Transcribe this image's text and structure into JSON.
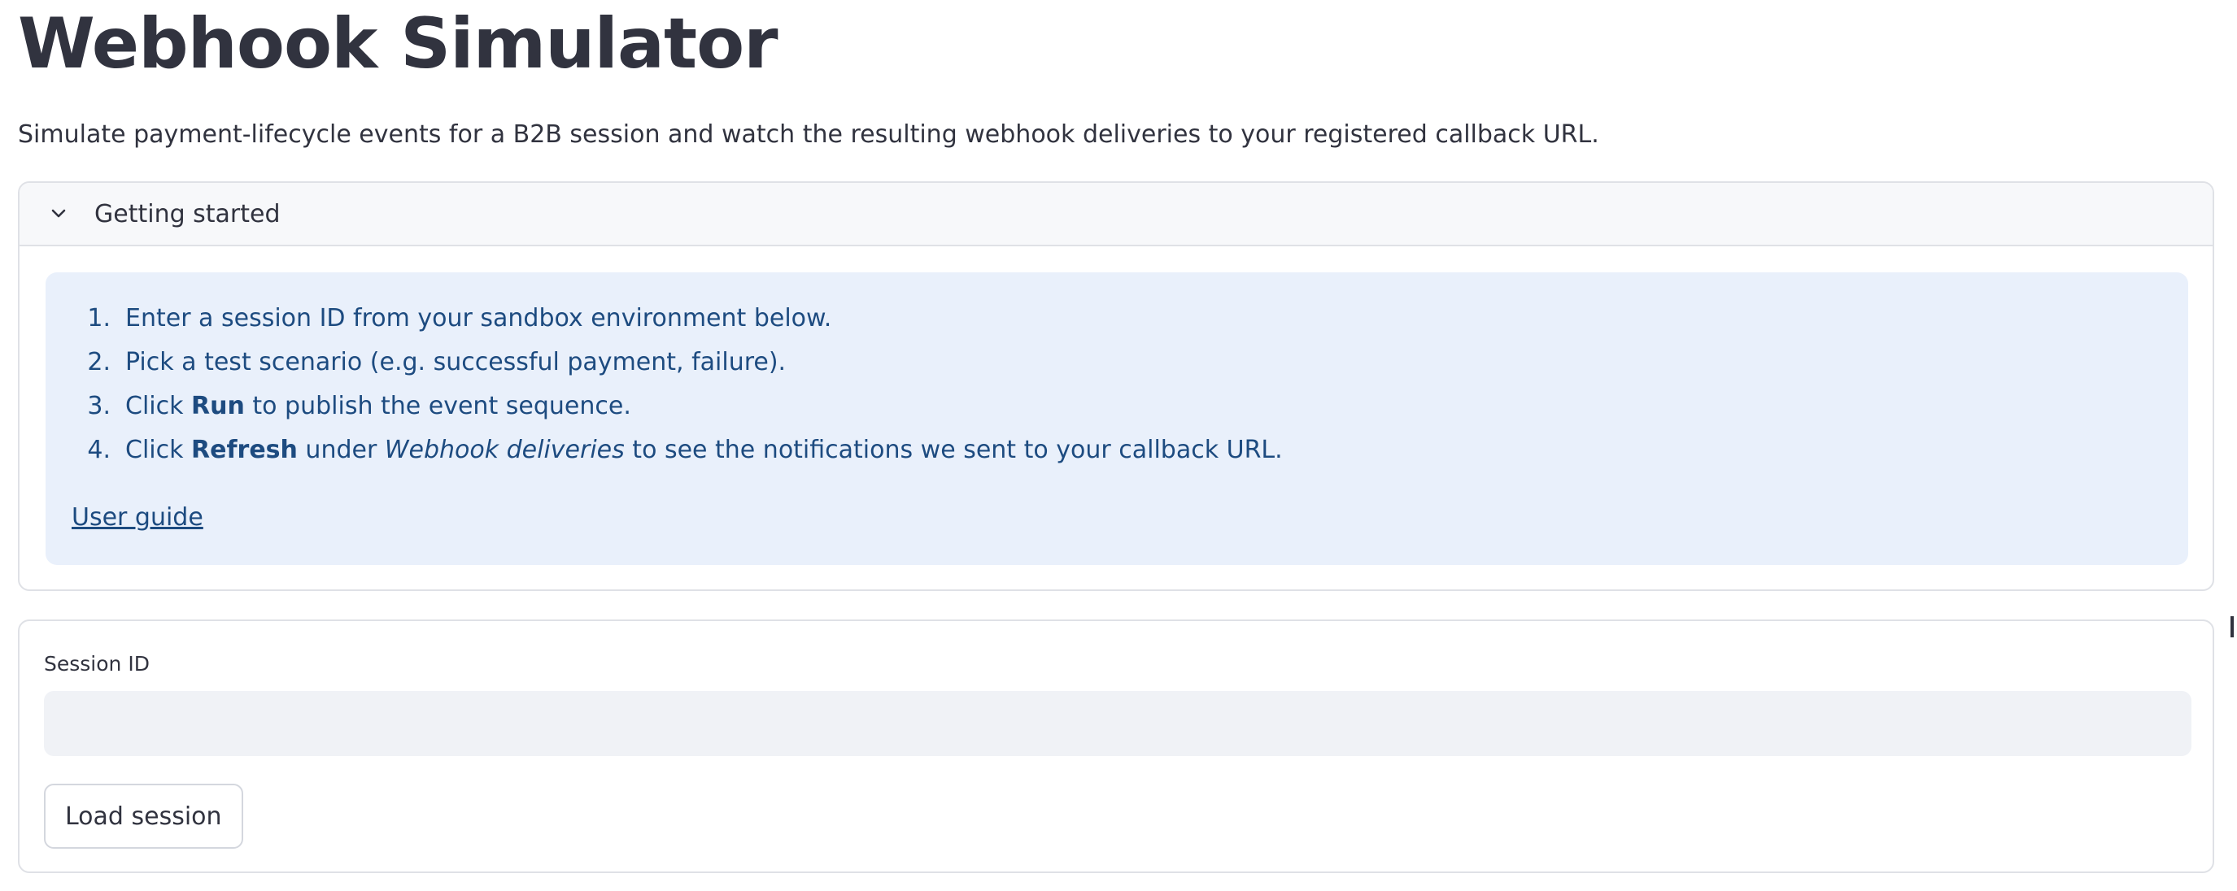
{
  "page": {
    "title": "Webhook Simulator",
    "subtitle": "Simulate payment-lifecycle events for a B2B session and watch the resulting webhook deliveries to your registered callback URL."
  },
  "expander": {
    "label": "Getting started",
    "expanded": true,
    "icon": "chevron-down-icon",
    "steps": [
      {
        "num": "1.",
        "text": "Enter a session ID from your sandbox environment below."
      },
      {
        "num": "2.",
        "text": "Pick a test scenario (e.g. successful payment, failure)."
      },
      {
        "num": "3.",
        "pre": "Click ",
        "bold": "Run",
        "post": " to publish the event sequence."
      },
      {
        "num": "4.",
        "pre": "Click ",
        "bold": "Refresh",
        "mid": " under ",
        "italic": "Webhook deliveries",
        "post": " to see the notifications we sent to your callback URL."
      }
    ],
    "link_label": "User guide"
  },
  "form": {
    "session_label": "Session ID",
    "session_value": "",
    "session_placeholder": "",
    "load_button": "Load session"
  },
  "colors": {
    "text": "#31333f",
    "info_bg": "#e9f0fb",
    "info_text": "#1d4b80",
    "border": "#dfe1e6",
    "input_bg": "#f0f2f6"
  }
}
